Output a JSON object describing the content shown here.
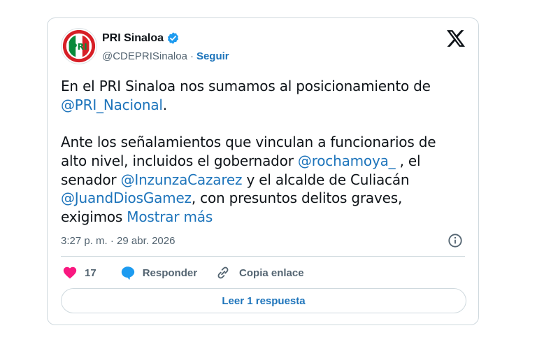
{
  "author": {
    "name": "PRI Sinaloa",
    "handle": "@CDEPRISinaloa",
    "separator": "·",
    "follow_label": "Seguir"
  },
  "tweet": {
    "line1_text": "En el PRI Sinaloa nos sumamos al posicionamiento de",
    "mention_nacional": "@PRI_Nacional",
    "line2_after": ".",
    "p2_a": "Ante los señalamientos que vinculan a funcionarios de alto nivel, incluidos el gobernador ",
    "mention_rocha": "@rochamoya_",
    "p2_b": " , el senador ",
    "mention_inzunza": "@InzunzaCazarez",
    "p2_c": " y el alcalde de Culiacán ",
    "mention_juand": "@JuandDiosGamez",
    "p2_d": ", con presuntos delitos graves, exigimos ",
    "show_more": "Mostrar más"
  },
  "timestamp": "3:27 p. m. · 29 abr. 2026",
  "actions": {
    "like_count": "17",
    "reply_label": "Responder",
    "copy_label": "Copia enlace"
  },
  "read_replies_label": "Leer 1 respuesta",
  "icons": {
    "verified": "verified-badge-icon",
    "x_logo": "x-logo-icon",
    "info": "info-icon",
    "heart": "heart-icon",
    "reply": "speech-bubble-icon",
    "link": "link-icon"
  },
  "colors": {
    "link_blue": "#1d74bb",
    "verified_blue": "#1d9bf0",
    "heart_pink": "#f91880",
    "muted_text": "#536471",
    "border": "#cfd9de",
    "pri_red": "#d71f26",
    "pri_green": "#0a8a3a"
  }
}
